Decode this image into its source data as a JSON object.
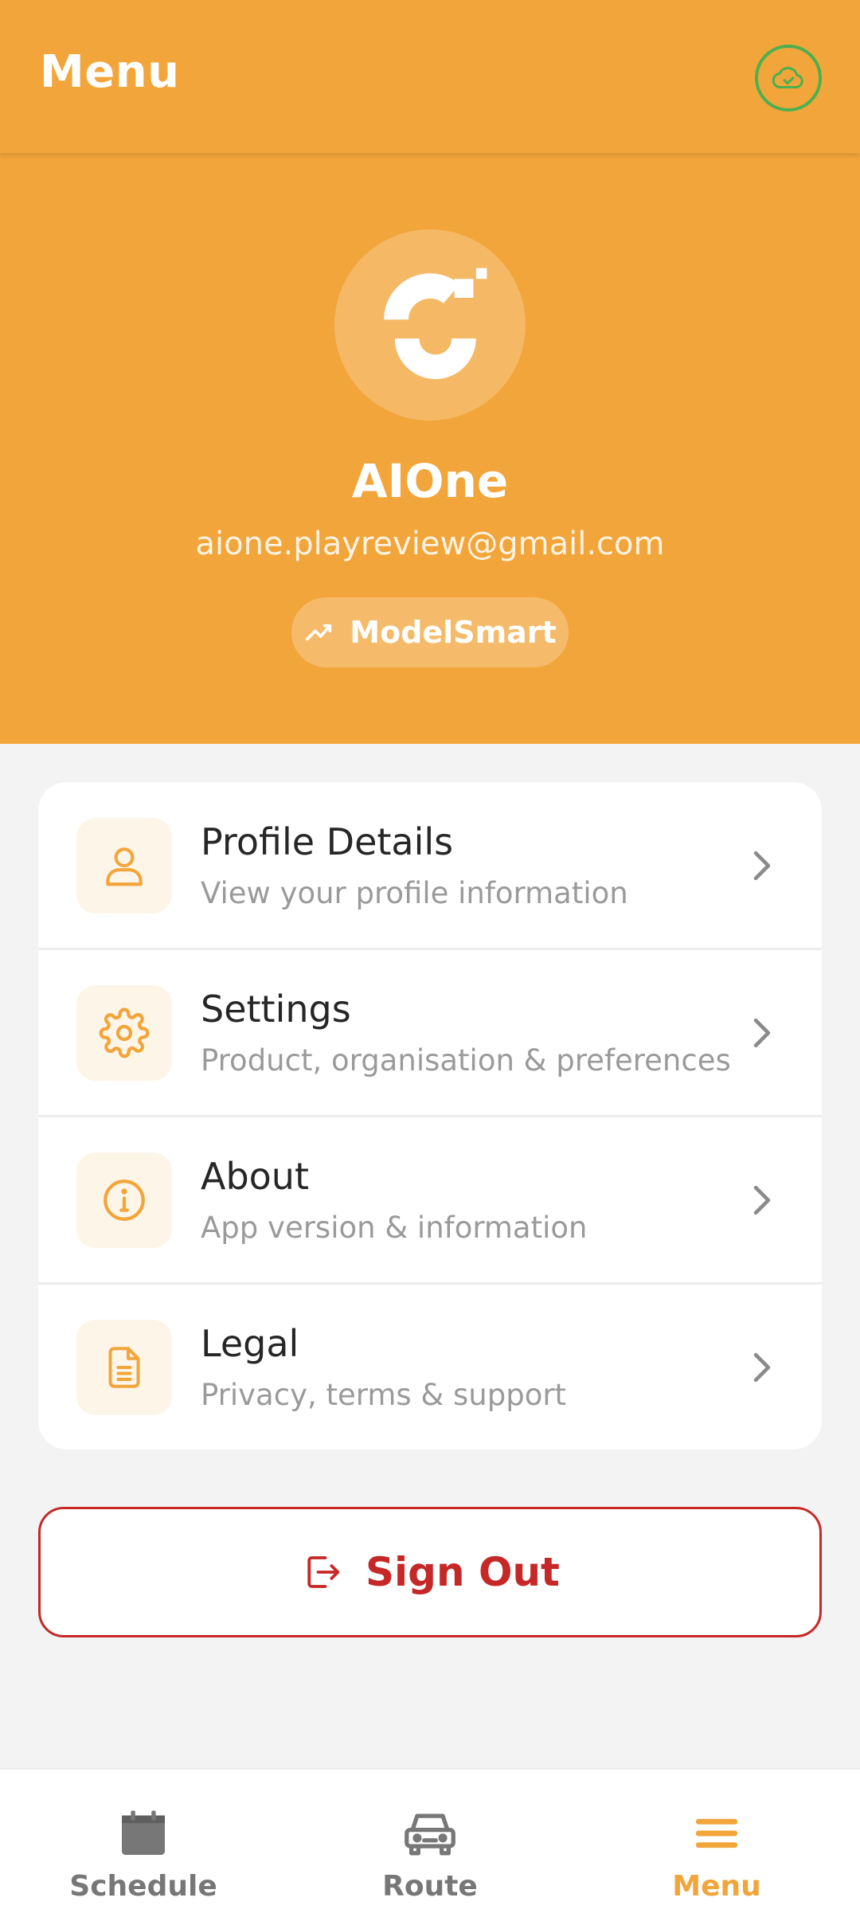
{
  "header": {
    "title": "Menu",
    "sync_icon": "cloud-check-icon",
    "sync_color": "#4caf50"
  },
  "profile": {
    "name": "AIOne",
    "email": "aione.playreview@gmail.com",
    "product_chip": "ModelSmart",
    "avatar_icon": "brand-logo-icon"
  },
  "menu": {
    "items": [
      {
        "title": "Profile Details",
        "subtitle": "View your profile information",
        "icon": "user-icon"
      },
      {
        "title": "Settings",
        "subtitle": "Product, organisation & preferences",
        "icon": "gear-icon"
      },
      {
        "title": "About",
        "subtitle": "App version & information",
        "icon": "info-icon"
      },
      {
        "title": "Legal",
        "subtitle": "Privacy, terms & support",
        "icon": "document-icon"
      }
    ]
  },
  "signout": {
    "label": "Sign Out",
    "icon": "logout-icon"
  },
  "bottom_nav": {
    "items": [
      {
        "label": "Schedule",
        "icon": "calendar-icon",
        "active": false
      },
      {
        "label": "Route",
        "icon": "car-icon",
        "active": false
      },
      {
        "label": "Menu",
        "icon": "hamburger-icon",
        "active": true
      }
    ]
  },
  "colors": {
    "brand": "#f2a53a",
    "danger": "#c62828",
    "inactive": "#777777"
  }
}
